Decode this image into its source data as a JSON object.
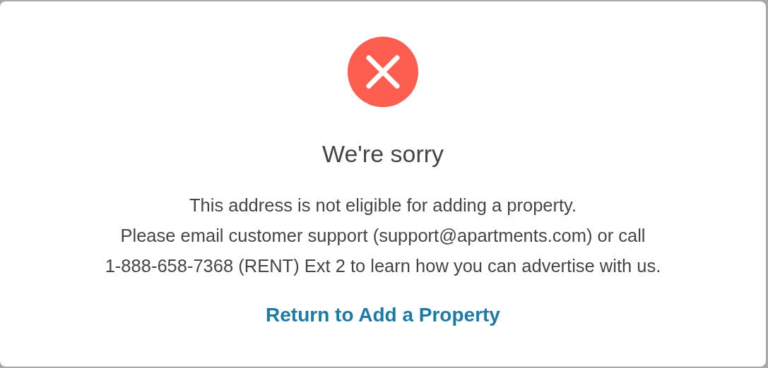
{
  "dialog": {
    "title": "We're sorry",
    "message_lines": [
      "This address is not eligible for adding a property.",
      "Please email customer support (support@apartments.com) or call",
      "1-888-658-7368 (RENT) Ext 2 to learn how you can advertise with us."
    ],
    "link": "Return to Add a Property"
  }
}
